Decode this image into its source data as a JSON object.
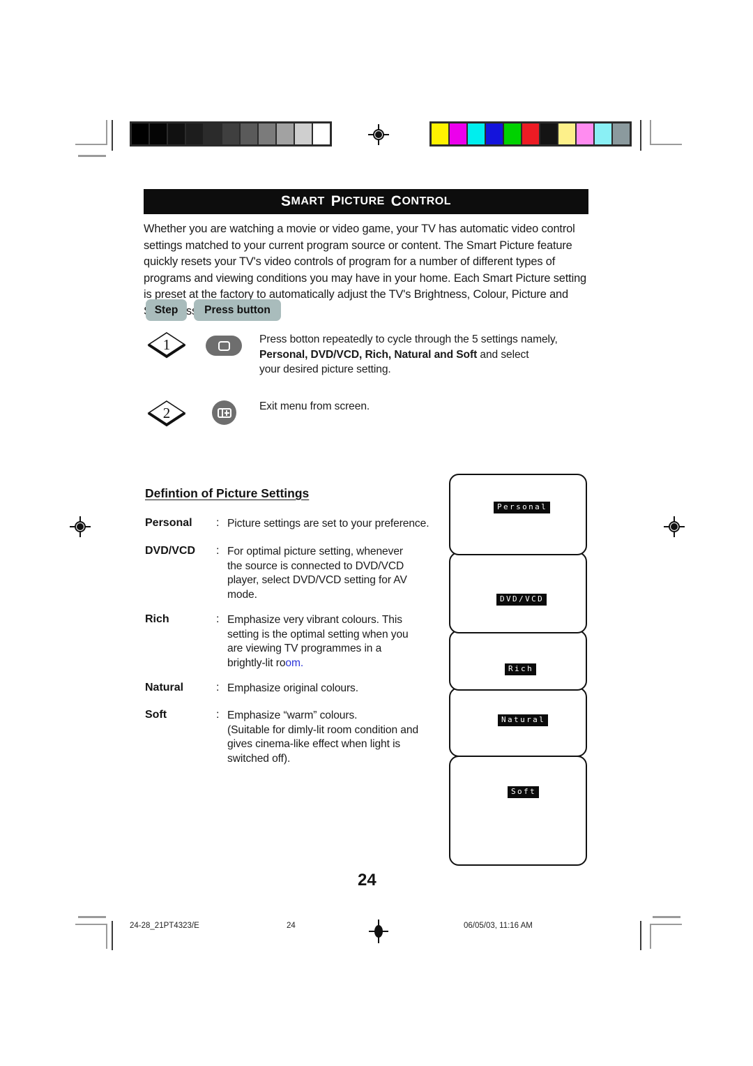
{
  "document": {
    "section_title_full": "SMART PICTURE CONTROL",
    "section_title_parts": [
      "S",
      "MART",
      "P",
      "ICTURE",
      "C",
      "ONTROL"
    ],
    "page_number": "24"
  },
  "intro": {
    "paragraph": "Whether you are watching a movie or video game, your TV has automatic video control settings matched to your current program source or content. The Smart Picture feature quickly resets your TV's video controls of program for a number of different types of programs and viewing conditions you may have in your home. Each Smart Picture setting is preset at the factory to automatically adjust the TV's Brightness, Colour, Picture and Sharpness levels."
  },
  "steps_table": {
    "header": {
      "step_label": "Step",
      "press_button_label": "Press button"
    },
    "rows": [
      {
        "number": "1",
        "icon": "tv-screen-button-icon",
        "text_line1": "Press botton repeatedly to cycle through the 5 settings namely,",
        "bold_terms": "Personal, DVD/VCD, Rich, Natural and Soft",
        "text_line2_tail": " and select",
        "text_line3": "your desired picture setting."
      },
      {
        "number": "2",
        "icon": "menu-exit-button-icon",
        "text_line1": "Exit menu from screen."
      }
    ]
  },
  "definitions": {
    "heading": "Defintion of Picture Settings",
    "colon": ":",
    "items": [
      {
        "term": "Personal",
        "lines": [
          "Picture settings are set to your preference."
        ]
      },
      {
        "term": "DVD/VCD",
        "lines": [
          "For optimal picture setting, whenever",
          "the source is connected to DVD/VCD",
          "player, select DVD/VCD setting for AV",
          "mode."
        ]
      },
      {
        "term": "Rich",
        "lines": [
          "Emphasize very vibrant colours. This",
          "setting is the optimal setting when you",
          "are viewing TV programmes in a",
          "brightly-lit ro"
        ],
        "last_line_blue_tail": "om."
      },
      {
        "term": "Natural",
        "lines": [
          "Emphasize original colours."
        ]
      },
      {
        "term": "Soft",
        "lines": [
          "Emphasize “warm” colours.",
          "(Suitable for dimly-lit room condition and",
          "gives cinema-like effect when light is",
          "switched off)."
        ]
      }
    ]
  },
  "screen_stack": {
    "labels": [
      "Personal",
      "DVD/VCD",
      "Rich",
      "Natural",
      "Soft"
    ]
  },
  "print_marks": {
    "grayscale_wedge": [
      "#000000",
      "#050505",
      "#111111",
      "#1d1d1d",
      "#2b2b2b",
      "#3f3f3f",
      "#5a5a5a",
      "#7b7b7b",
      "#a2a2a2",
      "#cfcfcf",
      "#ffffff"
    ],
    "color_bar": [
      "#fff200",
      "#ec00ec",
      "#00eeee",
      "#1414dc",
      "#00d200",
      "#ed1c24",
      "#141414",
      "#fdf08a",
      "#ff8cf0",
      "#8af0f5",
      "#8b9a9e"
    ]
  },
  "footer": {
    "file_ref": "24-28_21PT4323/E",
    "page": "24",
    "timestamp": "06/05/03, 11:16 AM"
  }
}
